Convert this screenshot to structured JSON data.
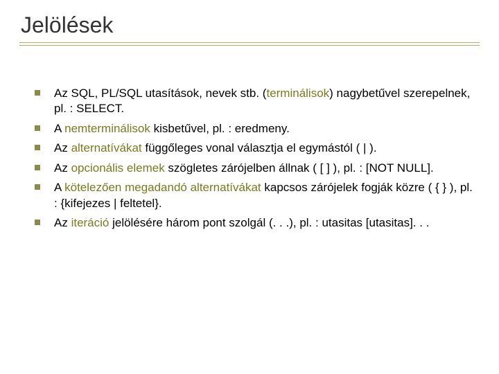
{
  "title": "Jelölések",
  "accent_color": "#7a7a1f",
  "bullet_color": "#8a8a4a",
  "rule_color": "#bda86e",
  "items": [
    {
      "pre1": "Az SQL, PL/SQL utasítások, nevek stb. (",
      "hl1": "terminálisok",
      "post1": ") nagybetűvel szerepelnek, pl. : SELECT."
    },
    {
      "pre1": "A ",
      "hl1": "nemterminálisok",
      "post1": " kisbetűvel, pl. : eredmeny."
    },
    {
      "pre1": "Az ",
      "hl1": "alternatívákat",
      "post1": " függőleges vonal választja el egymástól ( | )."
    },
    {
      "pre1": "Az ",
      "hl1": "opcionális elemek",
      "post1": " szögletes zárójelben állnak ( [ ] ), pl. : [NOT NULL]."
    },
    {
      "pre1": "A ",
      "hl1": "kötelezően megadandó alternatívákat",
      "post1": " kapcsos zárójelek fogják közre ( { } ), pl. : {kifejezes | feltetel}."
    },
    {
      "pre1": "Az ",
      "hl1": "iteráció",
      "post1": " jelölésére három pont szolgál (. . .), pl. : utasitas [utasitas]. . ."
    }
  ]
}
